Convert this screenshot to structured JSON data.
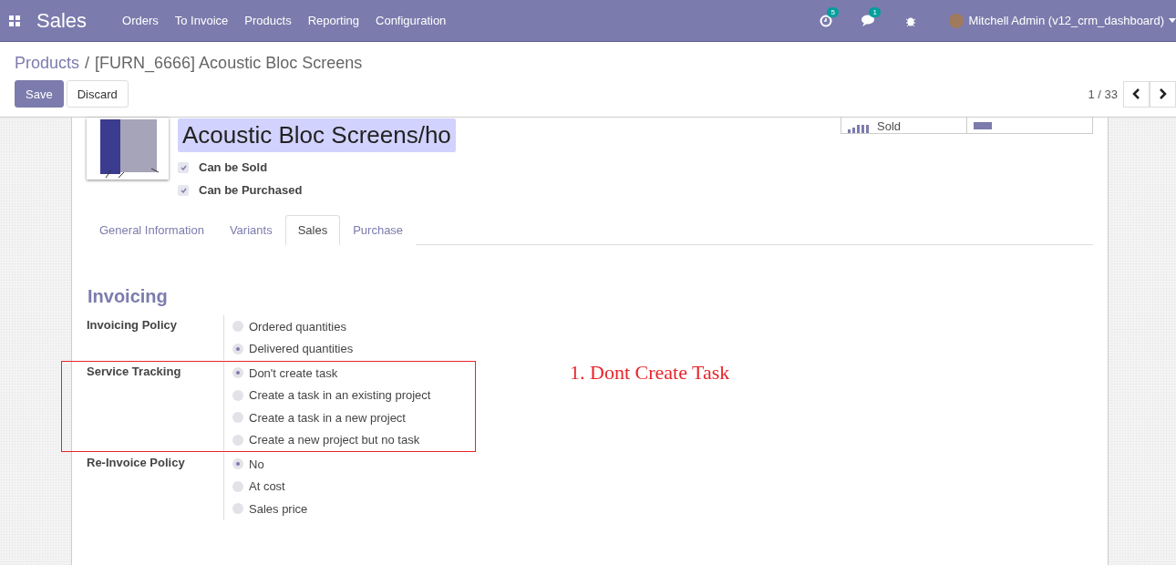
{
  "navbar": {
    "app": "Sales",
    "menu": [
      "Orders",
      "To Invoice",
      "Products",
      "Reporting",
      "Configuration"
    ],
    "activity_count": "5",
    "message_count": "1",
    "user": "Mitchell Admin (v12_crm_dashboard)"
  },
  "breadcrumb": {
    "parent": "Products",
    "separator": "/",
    "current": "[FURN_6666] Acoustic Bloc Screens"
  },
  "buttons": {
    "save": "Save",
    "discard": "Discard"
  },
  "pager": {
    "value": "1 / 33"
  },
  "stat_buttons": [
    {
      "kind": "sold",
      "label": "Sold"
    },
    {
      "kind": "toggle"
    }
  ],
  "product": {
    "name": "Acoustic Bloc Screens/ho",
    "options": [
      {
        "label": "Can be Sold",
        "checked": true
      },
      {
        "label": "Can be Purchased",
        "checked": true
      }
    ]
  },
  "tabs": [
    {
      "label": "General Information",
      "selected": false
    },
    {
      "label": "Variants",
      "selected": false
    },
    {
      "label": "Sales",
      "selected": true
    },
    {
      "label": "Purchase",
      "selected": false
    }
  ],
  "section_title": "Invoicing",
  "groups": [
    {
      "label": "Invoicing Policy",
      "highlighted": false,
      "options": [
        {
          "label": "Ordered quantities",
          "selected": false
        },
        {
          "label": "Delivered quantities",
          "selected": true
        }
      ]
    },
    {
      "label": "Service Tracking",
      "highlighted": true,
      "options": [
        {
          "label": "Don't create task",
          "selected": true
        },
        {
          "label": "Create a task in an existing project",
          "selected": false
        },
        {
          "label": "Create a task in a new project",
          "selected": false
        },
        {
          "label": "Create a new project but no task",
          "selected": false
        }
      ]
    },
    {
      "label": "Re-Invoice Policy",
      "highlighted": false,
      "options": [
        {
          "label": "No",
          "selected": true
        },
        {
          "label": "At cost",
          "selected": false
        },
        {
          "label": "Sales price",
          "selected": false
        }
      ]
    }
  ],
  "annotation": "1. Dont Create Task"
}
